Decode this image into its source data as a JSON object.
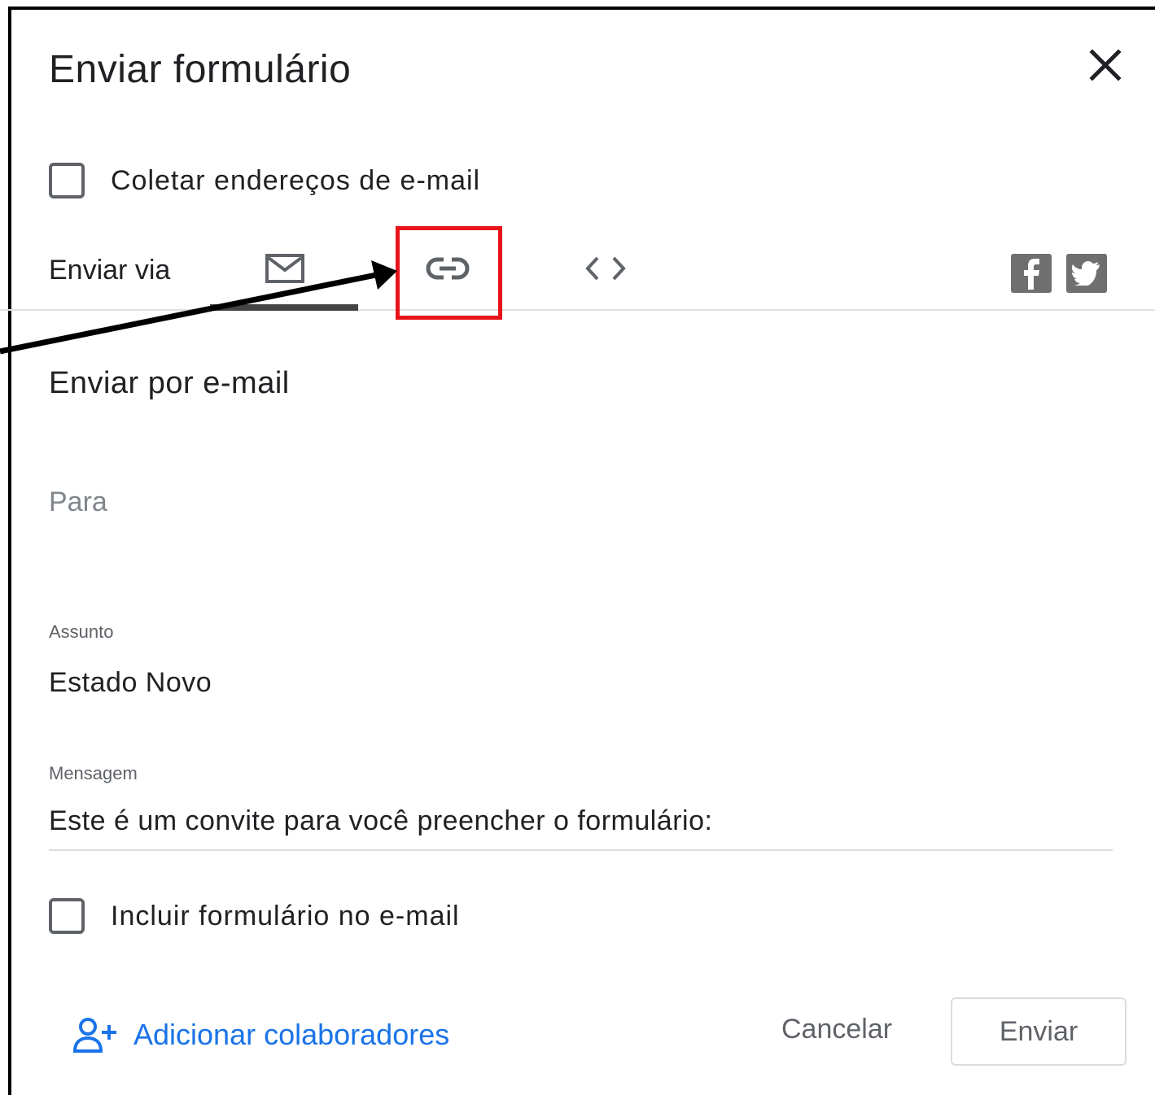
{
  "dialog": {
    "title": "Enviar formulário",
    "collect_emails_label": "Coletar endereços de e-mail",
    "send_via_label": "Enviar via",
    "tabs": [
      {
        "icon": "envelope-icon",
        "selected": true
      },
      {
        "icon": "link-icon",
        "selected": false
      },
      {
        "icon": "embed-code-icon",
        "selected": false
      }
    ],
    "social": [
      "facebook-icon",
      "twitter-icon"
    ]
  },
  "email": {
    "section_title": "Enviar por e-mail",
    "to_placeholder": "Para",
    "subject_label": "Assunto",
    "subject_value": "Estado Novo",
    "message_label": "Mensagem",
    "message_value": "Este é um convite para você preencher o formulário:",
    "include_form_label": "Incluir formulário no e-mail"
  },
  "footer": {
    "add_collaborators": "Adicionar colaboradores",
    "cancel": "Cancelar",
    "send": "Enviar"
  },
  "colors": {
    "highlight": "#e8121b",
    "link": "#1a73e8",
    "social_bg": "#6f6f6f"
  }
}
